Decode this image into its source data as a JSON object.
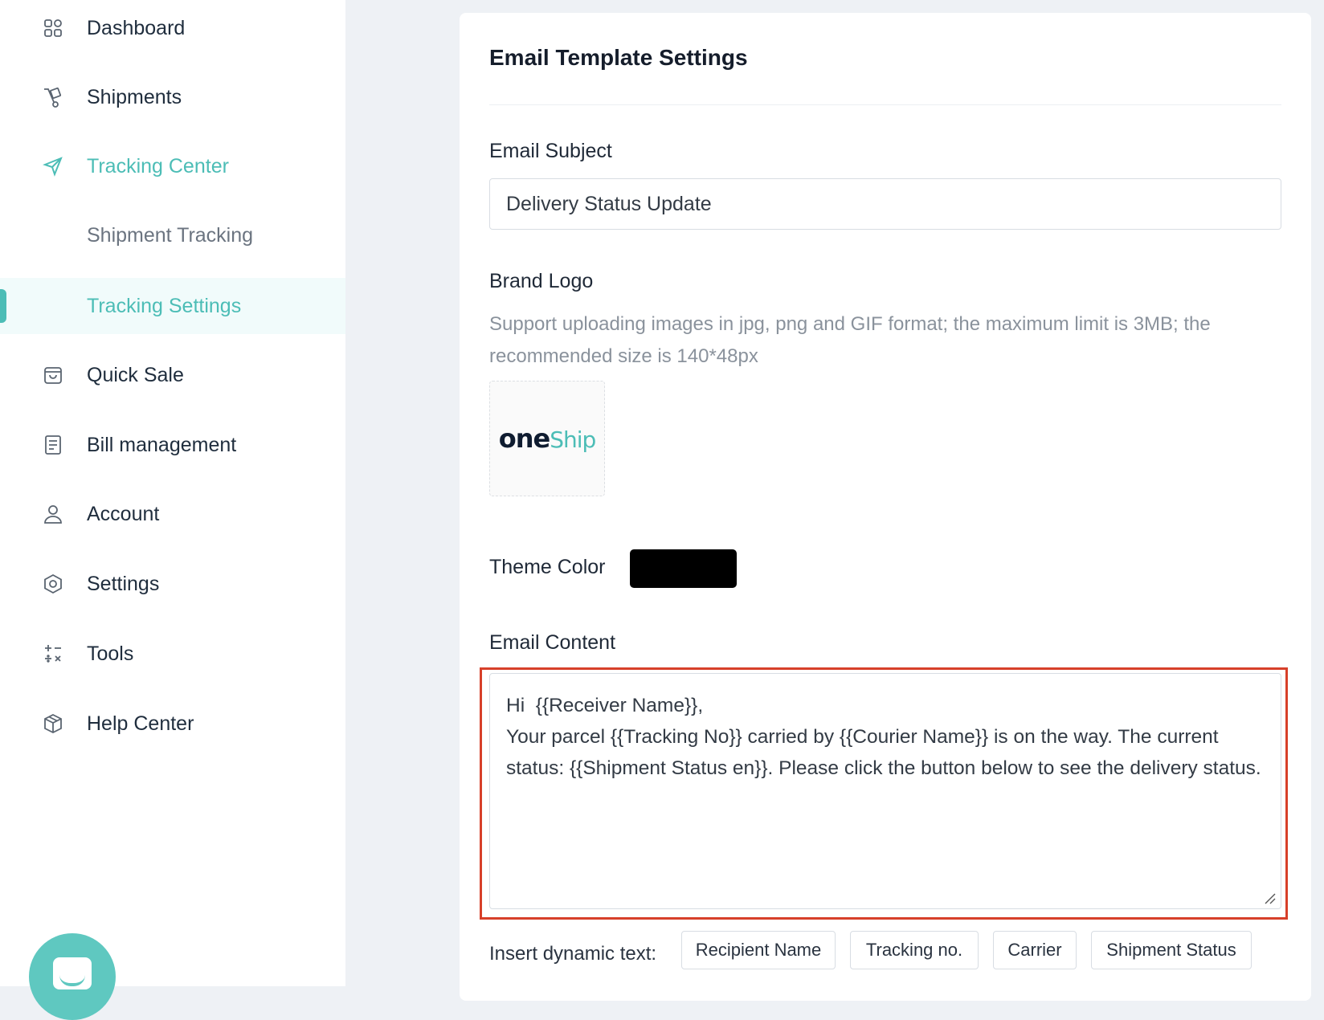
{
  "sidebar": {
    "items": [
      {
        "label": "Dashboard",
        "icon": "dashboard-icon"
      },
      {
        "label": "Shipments",
        "icon": "shipments-icon"
      },
      {
        "label": "Tracking Center",
        "icon": "send-icon"
      },
      {
        "label": "Shipment Tracking"
      },
      {
        "label": "Tracking Settings"
      },
      {
        "label": "Quick Sale",
        "icon": "bag-icon"
      },
      {
        "label": "Bill management",
        "icon": "bill-icon"
      },
      {
        "label": "Account",
        "icon": "user-icon"
      },
      {
        "label": "Settings",
        "icon": "gear-icon"
      },
      {
        "label": "Tools",
        "icon": "tools-icon"
      },
      {
        "label": "Help Center",
        "icon": "box-icon"
      }
    ]
  },
  "card": {
    "title": "Email Template Settings",
    "subject": {
      "label": "Email Subject",
      "value": "Delivery Status Update"
    },
    "logo": {
      "label": "Brand Logo",
      "hint": "Support uploading images in jpg, png and GIF format; the maximum limit is 3MB; the recommended size is 140*48px",
      "brand_part1": "one",
      "brand_part2": "Ship"
    },
    "theme": {
      "label": "Theme Color",
      "color": "#000000"
    },
    "content": {
      "label": "Email Content",
      "value": "Hi  {{Receiver Name}},\nYour parcel {{Tracking No}} carried by {{Courier Name}} is on the way. The current status: {{Shipment Status en}}. Please click the button below to see the delivery status."
    },
    "dynamic": {
      "label": "Insert dynamic text:",
      "chips": [
        "Recipient Name",
        "Tracking no.",
        "Carrier",
        "Shipment Status"
      ]
    }
  },
  "colors": {
    "accent": "#4cbdb6",
    "highlight": "#d7402a"
  }
}
